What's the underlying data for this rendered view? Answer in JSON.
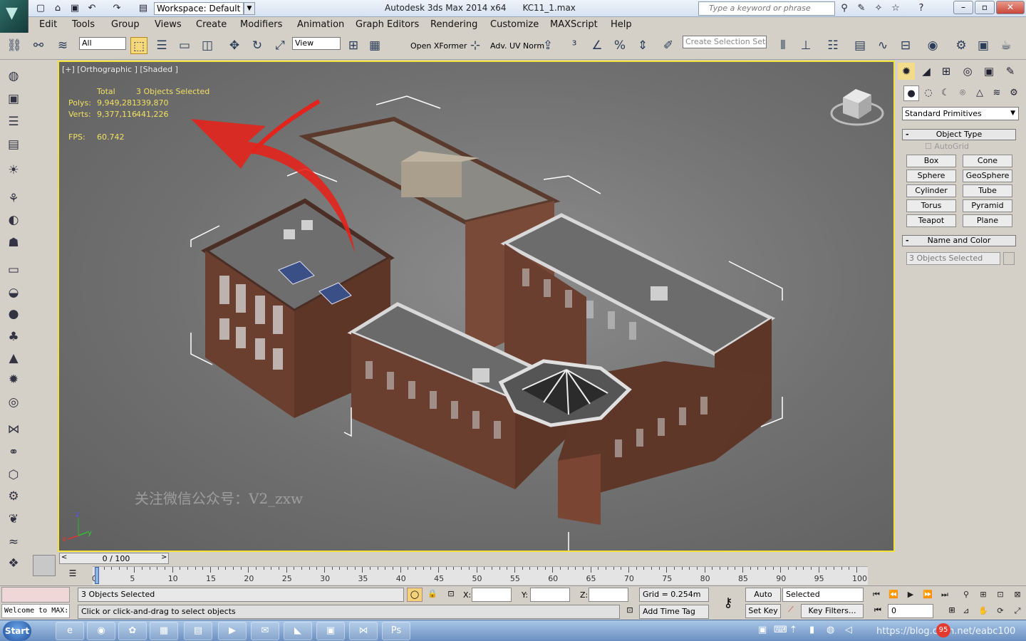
{
  "app": {
    "logo_icon": "3ds-max-logo-icon",
    "title": "Autodesk 3ds Max  2014 x64",
    "file_name": "KC11_1.max",
    "workspace_label": "Workspace: Default",
    "search_placeholder": "Type a keyword or phrase"
  },
  "menu": [
    "Edit",
    "Tools",
    "Group",
    "Views",
    "Create",
    "Modifiers",
    "Animation",
    "Graph Editors",
    "Rendering",
    "Customize",
    "MAXScript",
    "Help"
  ],
  "toolbar": {
    "selection_filter": "All",
    "reference_coord": "View",
    "open_xformer": "Open XFormer",
    "adv_uv": "Adv. UV Norm",
    "named_selection_placeholder": "Create Selection Set"
  },
  "viewport": {
    "label": "[+] [Orthographic ] [Shaded ]",
    "stats": {
      "col_total": "Total",
      "col_selected": "3 Objects Selected",
      "polys_label": "Polys:",
      "polys_total": "9,949,281",
      "polys_selected": "339,870",
      "verts_label": "Verts:",
      "verts_total": "9,377,116",
      "verts_selected": "441,226",
      "fps_label": "FPS:",
      "fps_value": "60.742"
    },
    "watermark": "关注微信公众号：V2_zxw",
    "active_border_color": "#f2e23a"
  },
  "command_panel": {
    "category": "Standard Primitives",
    "object_type_title": "Object Type",
    "autogrid": "AutoGrid",
    "primitives": [
      "Box",
      "Cone",
      "Sphere",
      "GeoSphere",
      "Cylinder",
      "Tube",
      "Torus",
      "Pyramid",
      "Teapot",
      "Plane"
    ],
    "name_color_title": "Name and Color",
    "object_name": "3 Objects Selected"
  },
  "timeline": {
    "slider_label": "0 / 100",
    "ticks": [
      "0",
      "5",
      "10",
      "15",
      "20",
      "25",
      "30",
      "35",
      "40",
      "45",
      "50",
      "55",
      "60",
      "65",
      "70",
      "75",
      "80",
      "85",
      "90",
      "95",
      "100"
    ]
  },
  "status": {
    "maxscript": "Welcome to MAX:",
    "selection": "3 Objects Selected",
    "prompt": "Click or click-and-drag to select objects",
    "x_label": "X:",
    "y_label": "Y:",
    "z_label": "Z:",
    "grid": "Grid = 0.254m",
    "add_time_tag": "Add Time Tag",
    "auto_key": "Auto Key",
    "set_key": "Set Key",
    "key_mode": "Selected",
    "key_filters": "Key Filters...",
    "current_frame": "0"
  },
  "taskbar": {
    "start_label": "Start",
    "apps": [
      "ie-icon",
      "chrome-icon",
      "qq-icon",
      "folder-icon",
      "winrar-icon",
      "video-icon",
      "mail-icon",
      "3dsmax-icon",
      "vm-icon",
      "vs-icon",
      "ps-icon"
    ],
    "url": "https://blog.csdn.net/eabc100",
    "badge": "95"
  }
}
